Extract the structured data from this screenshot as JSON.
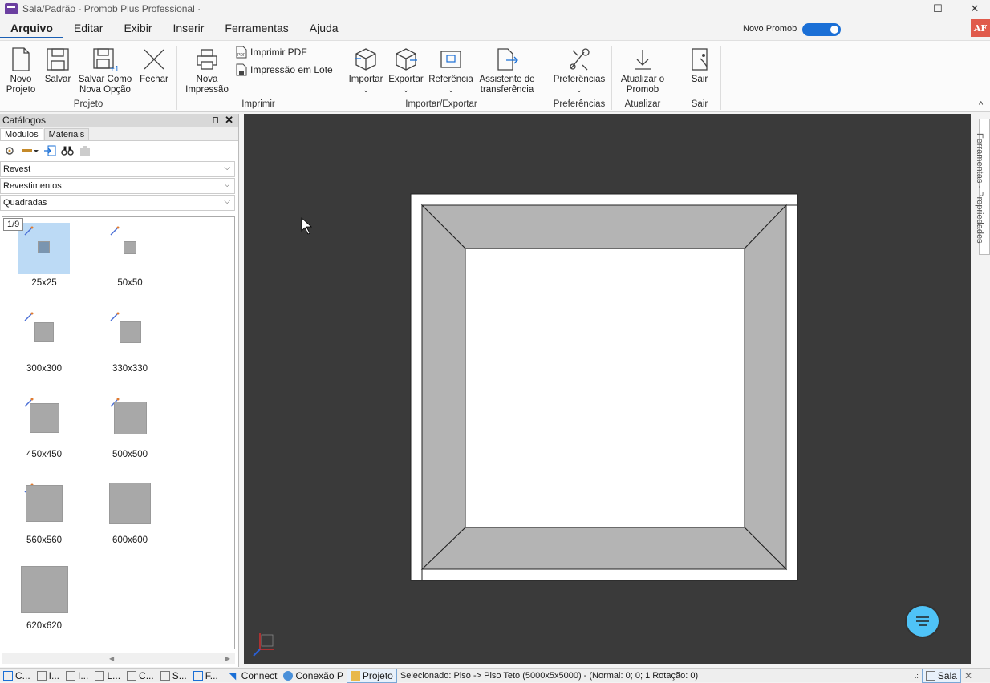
{
  "window": {
    "title": "Sala/Padrão - Promob Plus Professional ·",
    "minimize": "—",
    "maximize": "☐",
    "close": "✕"
  },
  "menu": {
    "items": [
      "Arquivo",
      "Editar",
      "Exibir",
      "Inserir",
      "Ferramentas",
      "Ajuda"
    ],
    "novo_promob_label": "Novo Promob",
    "novo_promob_on": true,
    "user_initials": "AF"
  },
  "ribbon": {
    "novo_projeto": "Novo\nProjeto",
    "salvar": "Salvar",
    "salvar_como": "Salvar Como\nNova Opção",
    "fechar": "Fechar",
    "group_projeto": "Projeto",
    "nova_impressao": "Nova\nImpressão",
    "imprimir_pdf": "Imprimir PDF",
    "impressao_lote": "Impressão em Lote",
    "group_imprimir": "Imprimir",
    "importar": "Importar",
    "exportar": "Exportar",
    "referencia": "Referência",
    "assistente": "Assistente de\ntransferência",
    "group_import_export": "Importar/Exportar",
    "preferencias": "Preferências",
    "group_preferencias": "Preferências",
    "atualizar": "Atualizar o\nPromob",
    "group_atualizar": "Atualizar",
    "sair": "Sair",
    "group_sair": "Sair",
    "collapse": "^"
  },
  "catalog": {
    "title": "Catálogos",
    "pin": "⊓",
    "close": "✕",
    "tabs": [
      "Módulos",
      "Materiais"
    ],
    "dropdown1": "Revest",
    "dropdown2": "Revestimentos",
    "dropdown3": "Quadradas",
    "page": "1/9",
    "items": [
      "25x25",
      "50x50",
      "300x300",
      "330x330",
      "450x450",
      "500x500",
      "560x560",
      "600x600",
      "620x620"
    ],
    "scroll_left": "◀",
    "scroll_right": "▶"
  },
  "side_panel": {
    "label": "Ferramentas - Propriedades"
  },
  "status": {
    "tabs": [
      "C...",
      "I...",
      "I...",
      "L...",
      "C...",
      "S...",
      "F..."
    ],
    "connect": "Connect",
    "conexao": "Conexão P",
    "projeto": "Projeto",
    "selected": "Selecionado: Piso -> Piso Teto (5000x5x5000) - (Normal: 0; 0; 1 Rotação: 0)",
    "dots": ".:",
    "sala": "Sala",
    "close": "✕"
  },
  "colors": {
    "accent": "#1a6fd6",
    "viewport_bg": "#3a3a3a",
    "selected_item": "#bcdaf5",
    "chat": "#4fc3f7"
  }
}
